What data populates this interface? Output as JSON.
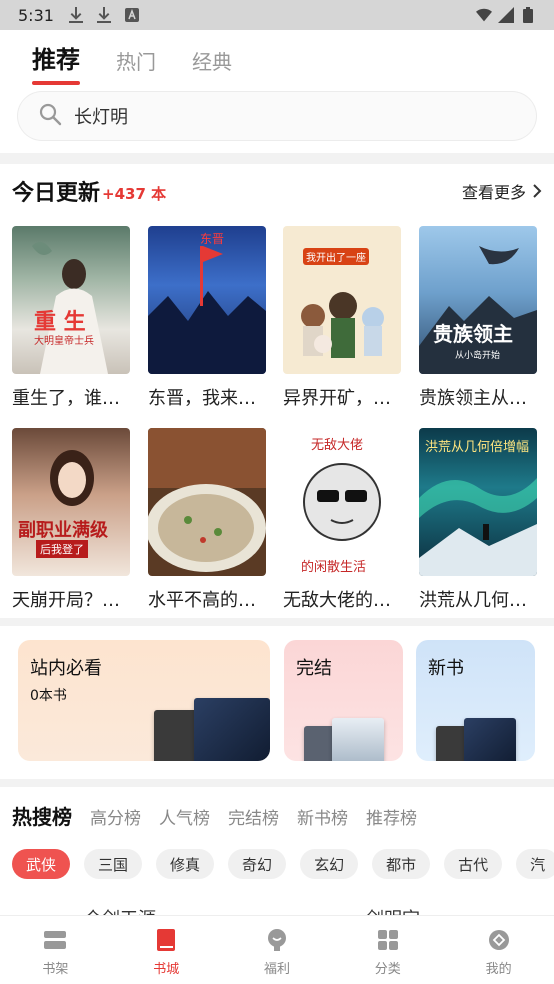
{
  "status": {
    "time": "5:31"
  },
  "top_tabs": [
    {
      "label": "推荐"
    },
    {
      "label": "热门"
    },
    {
      "label": "经典"
    }
  ],
  "search": {
    "value": "长灯明"
  },
  "today": {
    "title": "今日更新",
    "count": "+437 本",
    "more": "查看更多",
    "books": [
      {
        "title": "重生了，谁…",
        "cover_text": "重 生",
        "cover_sub": "大明皇帝士兵"
      },
      {
        "title": "东晋，我来…",
        "cover_text": "东晋"
      },
      {
        "title": "异界开矿，…",
        "cover_text": "我开出了一座"
      },
      {
        "title": "贵族领主从…",
        "cover_text": "贵族领主",
        "cover_sub": "从小岛开始"
      },
      {
        "title": "天崩开局？…",
        "cover_text": "副职业满级",
        "cover_sub": "后我登了"
      },
      {
        "title": "水平不高的…"
      },
      {
        "title": "无敌大佬的…",
        "cover_text": "无敌大佬",
        "cover_sub": "的闲散生活"
      },
      {
        "title": "洪荒从几何…",
        "cover_text": "洪荒从几何倍增幅"
      }
    ]
  },
  "collections": [
    {
      "title": "站内必看",
      "sub": "0本书"
    },
    {
      "title": "完结"
    },
    {
      "title": "新书"
    }
  ],
  "hot": {
    "tabs": [
      "热搜榜",
      "高分榜",
      "人气榜",
      "完结榜",
      "新书榜",
      "推荐榜"
    ],
    "genres": [
      "武侠",
      "三国",
      "修真",
      "奇幻",
      "玄幻",
      "都市",
      "古代",
      "汽"
    ],
    "peek": [
      "仓剑天涯",
      "剑明宗"
    ]
  },
  "nav": [
    {
      "label": "书架"
    },
    {
      "label": "书城"
    },
    {
      "label": "福利"
    },
    {
      "label": "分类"
    },
    {
      "label": "我的"
    }
  ],
  "colors": {
    "accent": "#e53935"
  }
}
